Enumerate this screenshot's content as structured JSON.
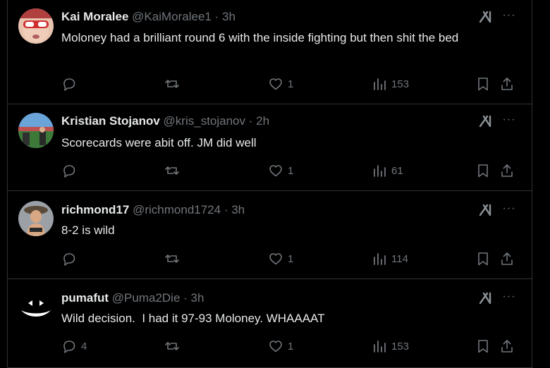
{
  "replies": [
    {
      "name": "Kai Moralee",
      "handle": "@KaiMoralee1",
      "time": "3h",
      "text": "Moloney had a brilliant round 6 with the inside fighting but then shit the bed",
      "replies_count": "",
      "likes": "1",
      "views": "153"
    },
    {
      "name": "Kristian Stojanov",
      "handle": "@kris_stojanov",
      "time": "2h",
      "text": "Scorecards were abit off. JM did well",
      "replies_count": "",
      "likes": "1",
      "views": "61"
    },
    {
      "name": "richmond17",
      "handle": "@richmond1724",
      "time": "3h",
      "text": "8-2 is wild",
      "replies_count": "",
      "likes": "1",
      "views": "114"
    },
    {
      "name": "pumafut",
      "handle": "@Puma2Die",
      "time": "3h",
      "text": "Wild decision.  I had it 97-93 Moloney. WHAAAAT",
      "replies_count": "4",
      "likes": "1",
      "views": "153"
    }
  ],
  "separator": " · ",
  "icons": {
    "reply": "speech-bubble-icon",
    "repost": "repost-arrows-icon",
    "like": "heart-icon",
    "views": "bar-chart-icon",
    "bookmark": "bookmark-icon",
    "share": "share-upload-icon",
    "grok": "grok-logo-icon",
    "more": "more-dots-icon"
  },
  "colors": {
    "background": "#000000",
    "text": "#e7e9ea",
    "secondary": "#71767b",
    "border": "#2f3336"
  }
}
